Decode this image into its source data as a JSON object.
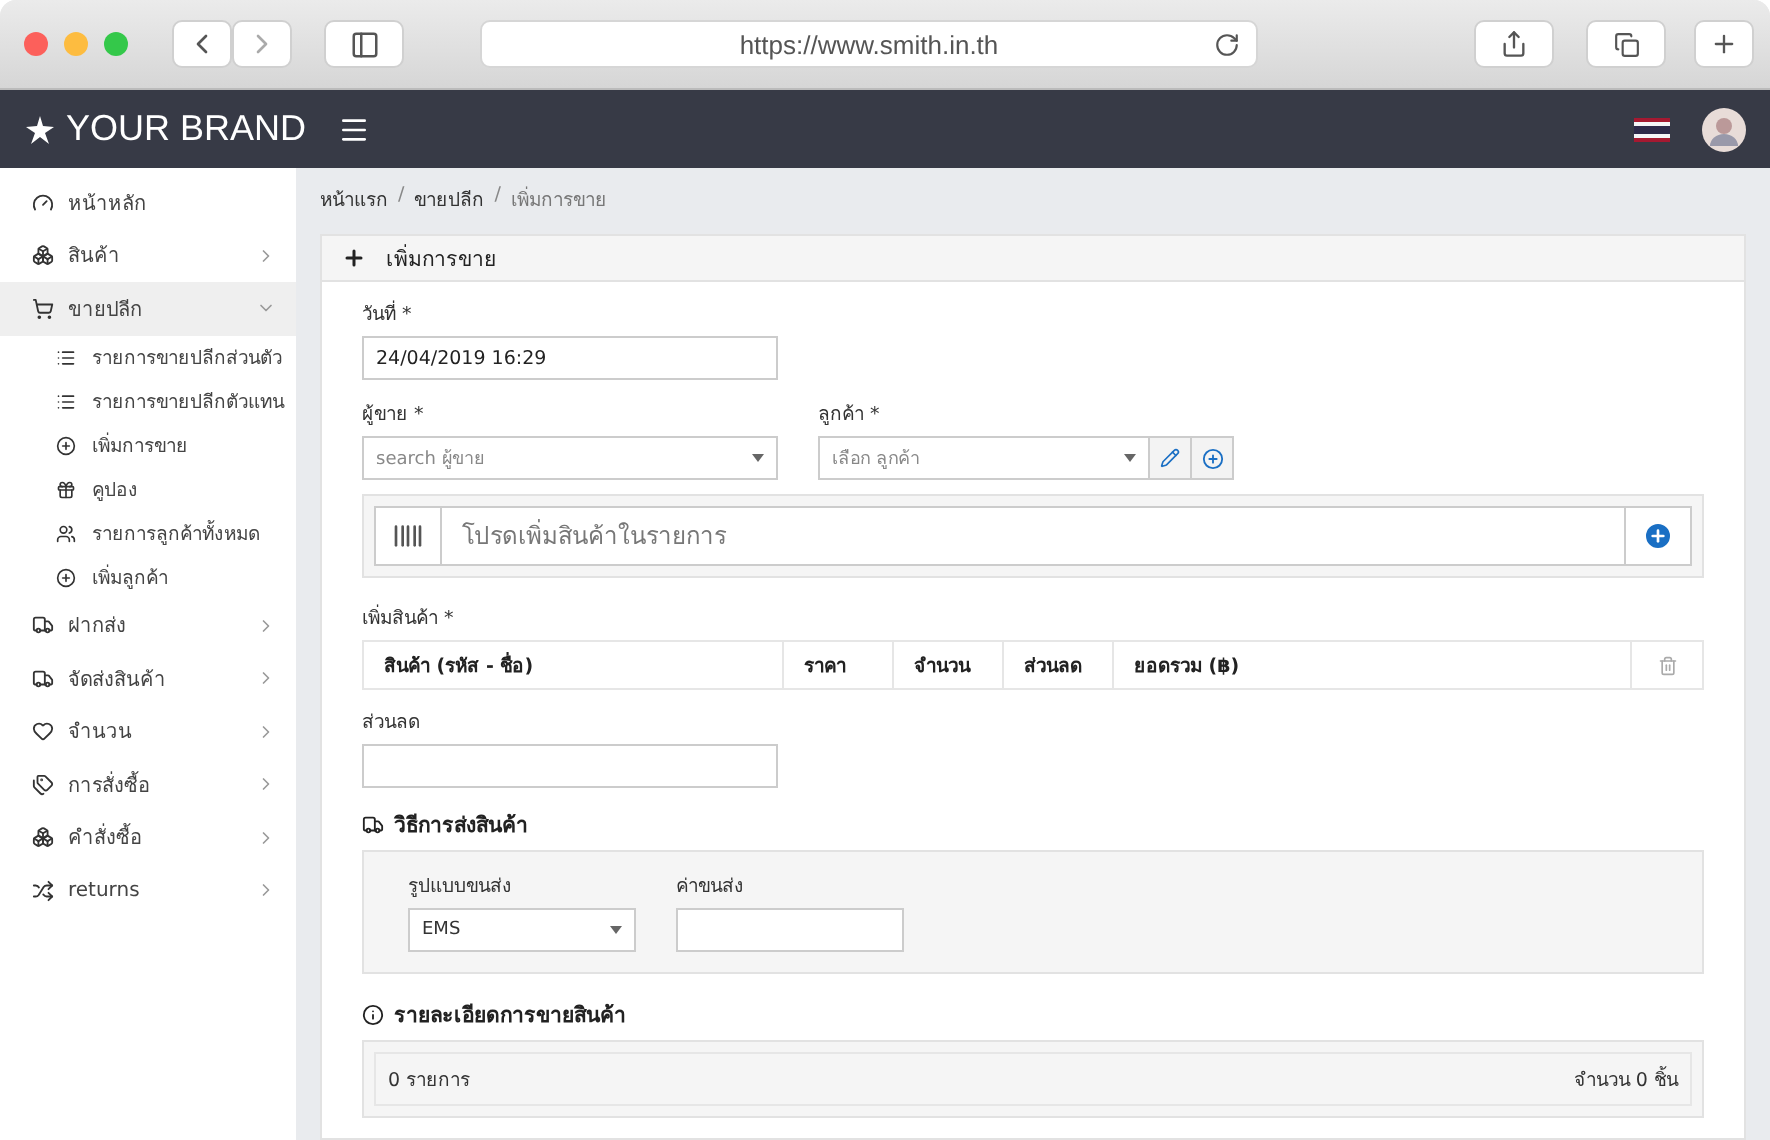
{
  "browser": {
    "url": "https://www.smith.in.th"
  },
  "topbar": {
    "brand": "YOUR BRAND"
  },
  "sidebar": {
    "items": [
      {
        "label": "หน้าหลัก"
      },
      {
        "label": "สินค้า",
        "expanded": false,
        "selected": false
      },
      {
        "label": "ขายปลีก",
        "expanded": true,
        "selected": true,
        "children": [
          {
            "label": "รายการขายปลีกส่วนตัว"
          },
          {
            "label": "รายการขายปลีกตัวแทน"
          },
          {
            "label": "เพิ่มการขาย"
          },
          {
            "label": "คูปอง"
          },
          {
            "label": "รายการลูกค้าทั้งหมด"
          },
          {
            "label": "เพิ่มลูกค้า"
          }
        ]
      },
      {
        "label": "ฝากส่ง",
        "expanded": false,
        "selected": false
      },
      {
        "label": "จัดส่งสินค้า",
        "expanded": false,
        "selected": false
      },
      {
        "label": "จำนวน",
        "expanded": false,
        "selected": false
      },
      {
        "label": "การสั่งซื้อ",
        "expanded": false,
        "selected": false
      },
      {
        "label": "คำสั่งซื้อ",
        "expanded": false,
        "selected": false
      },
      {
        "label": "returns",
        "expanded": false,
        "selected": false
      }
    ]
  },
  "breadcrumb": {
    "separator": "/",
    "items": [
      "หน้าแรก",
      "ขายปลีก",
      "เพิ่มการขาย"
    ]
  },
  "panel": {
    "title": "เพิ่มการขาย",
    "date": {
      "label": "วันที่ *",
      "value": "24/04/2019 16:29"
    },
    "seller": {
      "label": "ผู้ขาย *",
      "placeholder": "search ผู้ขาย"
    },
    "customer": {
      "label": "ลูกค้า *",
      "placeholder": "เลือก ลูกค้า"
    },
    "product_search": {
      "placeholder": "โปรดเพิ่มสินค้าในรายการ"
    },
    "products": {
      "label": "เพิ่มสินค้า *",
      "columns": [
        "สินค้า (รหัส - ชื่อ)",
        "ราคา",
        "จำนวน",
        "ส่วนลด",
        "ยอดรวม (฿)"
      ]
    },
    "discount": {
      "label": "ส่วนลด"
    },
    "shipping": {
      "title": "วิธีการส่งสินค้า",
      "method_label": "รูปแบบขนส่ง",
      "method_value": "EMS",
      "cost_label": "ค่าขนส่ง"
    },
    "details": {
      "title": "รายละเอียดการขายสินค้า",
      "count": "0 รายการ",
      "quantity": "จำนวน 0 ชิ้น"
    }
  }
}
